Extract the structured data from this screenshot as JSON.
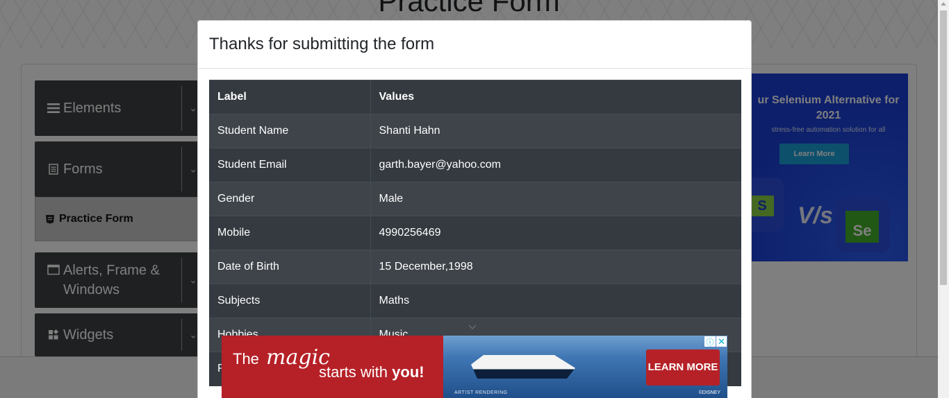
{
  "page": {
    "banner_title": "Practice Form"
  },
  "sidebar": {
    "groups": [
      {
        "label": "Elements",
        "icon": "hamburger-icon"
      },
      {
        "label": "Forms",
        "icon": "document-icon"
      },
      {
        "label": "Alerts, Frame & Windows",
        "icon": "window-icon"
      },
      {
        "label": "Widgets",
        "icon": "widgets-icon"
      }
    ],
    "active_item": {
      "label": "Practice Form",
      "icon": "html5-icon"
    }
  },
  "ad_right": {
    "title": "ur Selenium Alternative for 2021",
    "subtitle": "stress-free automation solution for all",
    "button": "Learn More",
    "vs_text": "V/s",
    "s_logo": "S",
    "se_logo": "Se"
  },
  "modal": {
    "title": "Thanks for submitting the form",
    "table": {
      "headers": [
        "Label",
        "Values"
      ],
      "rows": [
        [
          "Student Name",
          "Shanti Hahn"
        ],
        [
          "Student Email",
          "garth.bayer@yahoo.com"
        ],
        [
          "Gender",
          "Male"
        ],
        [
          "Mobile",
          "4990256469"
        ],
        [
          "Date of Birth",
          "15 December,1998"
        ],
        [
          "Subjects",
          "Maths"
        ],
        [
          "Hobbies",
          "Music"
        ],
        [
          "P",
          ""
        ]
      ]
    }
  },
  "ad_bottom": {
    "line1_prefix": "The",
    "line1_script": "magic",
    "line2_prefix": "starts with",
    "line2_bold": "you!",
    "cta": "LEARN MORE",
    "fine_print": "ARTIST RENDERING",
    "brand": "©DISNEY",
    "choices_icon": "adchoices-icon",
    "close_icon": "close-icon"
  },
  "colors": {
    "sidebar_bg": "#3c4043",
    "table_dark": "#343a40",
    "table_stripe": "#3e444a",
    "ad_red": "#b52127",
    "ad_blue": "#1a3fd6"
  }
}
